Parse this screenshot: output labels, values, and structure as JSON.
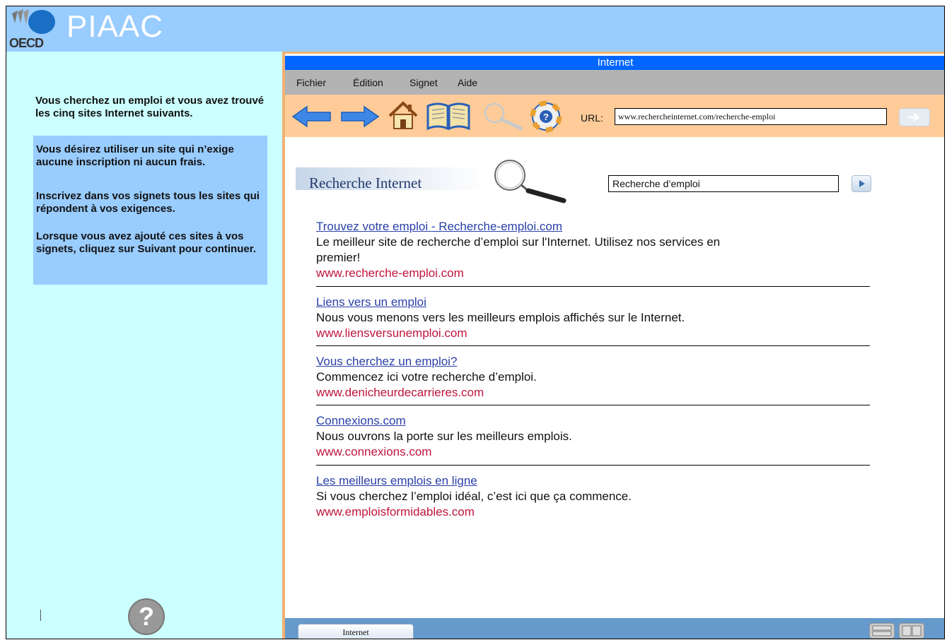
{
  "header": {
    "logo_text": "OECD",
    "title": "PIAAC"
  },
  "left_panel": {
    "intro": "Vous cherchez un emploi et vous avez trouvé les cinq sites Internet suivants.",
    "instructions": [
      "Vous désirez utiliser un site qui n’exige aucune inscription ni aucun frais.",
      "Inscrivez dans vos signets tous les sites qui répondent à vos exigences.",
      "Lorsque vous avez ajouté ces sites à vos signets, cliquez sur Suivant pour continuer."
    ],
    "help_label": "?"
  },
  "browser": {
    "title": "Internet",
    "menu": [
      "Fichier",
      "Édition",
      "Signet",
      "Aide"
    ],
    "toolbar": {
      "back": "back-arrow-icon",
      "forward": "forward-arrow-icon",
      "home": "home-icon",
      "bookmarks": "book-icon",
      "search": "magnifier-icon",
      "help": "help-icon",
      "url_label": "URL:",
      "url_value": "www.rechercheinternet.com/recherche-emploi"
    },
    "search": {
      "title": "Recherche Internet",
      "query": "Recherche d’emploi"
    },
    "results": [
      {
        "title": "Trouvez votre emploi - Recherche-emploi.com ",
        "description": "Le meilleur site de recherche d’emploi sur l'Internet. Utilisez nos services en premier!",
        "url": "www.recherche-emploi.com"
      },
      {
        "title": "Liens vers un emploi",
        "description": "Nous vous menons vers les meilleurs emplois affichés sur le Internet.",
        "url": "www.liensversunemploi.com"
      },
      {
        "title": "Vous cherchez un emploi? ",
        "description": "Commencez ici votre recherche d’emploi.",
        "url": "www.denicheurdecarrieres.com"
      },
      {
        "title": "Connexions.com ",
        "description": "Nous ouvrons la porte sur les meilleurs emplois.",
        "url": "www.connexions.com"
      },
      {
        "title": "Les meilleurs emplois en ligne",
        "description": "Si vous cherchez l’emploi idéal, c’est ici que ça commence.",
        "url": "www.emploisformidables.com"
      }
    ],
    "statusbar": {
      "tab_label": "Internet"
    }
  },
  "colors": {
    "header_bg": "#99ccff",
    "left_bg": "#ccffff",
    "instruction_bg": "#99ccff",
    "title_bar": "#0066ff",
    "menubar": "#b3b3b3",
    "toolbar": "#ffcc99",
    "statusbar": "#6699cc",
    "link": "#2a3fa8",
    "url_red": "#c0143c"
  }
}
